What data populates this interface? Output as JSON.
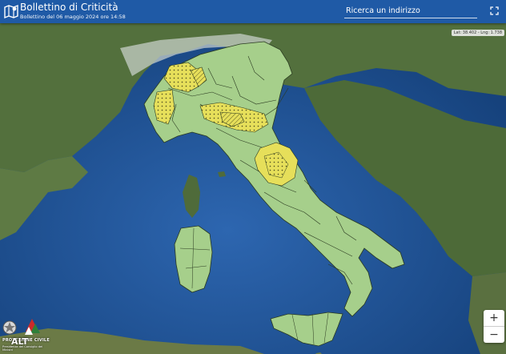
{
  "header": {
    "title": "Bollettino di Criticità",
    "subtitle": "Bollettino del 06 maggio 2024 ore 14:58"
  },
  "search": {
    "placeholder": "Ricerca un indirizzo"
  },
  "map": {
    "coords_text": "Lat: 38.402 - Lng: 1.738",
    "zoom_in_label": "+",
    "zoom_out_label": "−",
    "legend_colors": {
      "sea": "#1d4f8a",
      "land": "#4f6b3a",
      "zone_green": "#a6cf8b",
      "zone_yellow": "#e6df5a"
    }
  },
  "branding": {
    "alt_label": "ALT",
    "pc_label": "PROTEZIONE CIVILE",
    "pc_sub": "Presidenza del Consiglio dei Ministri"
  },
  "icons": {
    "logo": "map-icon",
    "fullscreen": "expand-icon"
  }
}
